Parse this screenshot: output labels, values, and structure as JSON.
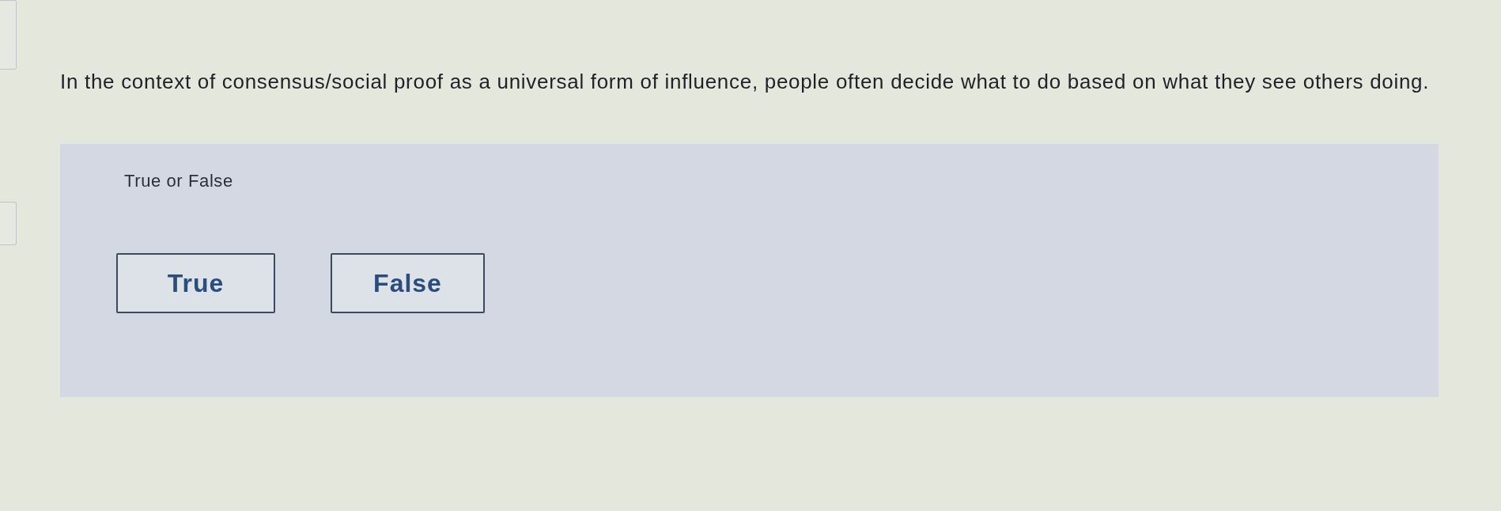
{
  "question": {
    "text": "In the context of consensus/social proof as a universal form of influence, people often decide what to do based on what they see others doing."
  },
  "answer_panel": {
    "prompt": "True or False",
    "options": [
      {
        "label": "True",
        "selected": false
      },
      {
        "label": "False",
        "selected": false
      }
    ]
  }
}
